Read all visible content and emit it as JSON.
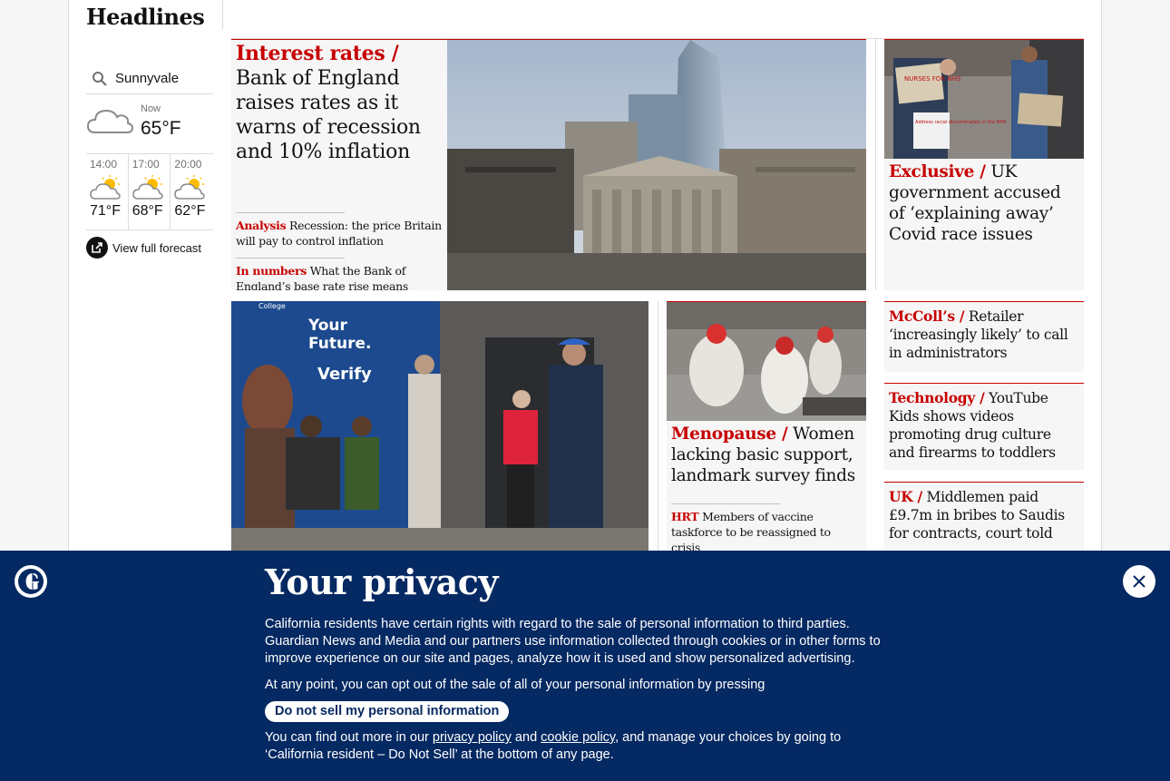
{
  "section": {
    "title": "Headlines"
  },
  "weather": {
    "location": "Sunnyvale",
    "now_label": "Now",
    "now_temp": "65°F",
    "forecast": [
      {
        "time": "14:00",
        "temp": "71°F"
      },
      {
        "time": "17:00",
        "temp": "68°F"
      },
      {
        "time": "20:00",
        "temp": "62°F"
      }
    ],
    "full_forecast_label": "View full forecast"
  },
  "main_story": {
    "kicker": "Interest rates /",
    "headline": "Bank of England raises rates as it warns of recession and 10% inflation",
    "sublinks": [
      {
        "kicker": "Analysis",
        "text": "Recession: the price Britain will pay to control inflation"
      },
      {
        "kicker": "In numbers",
        "text": "What the Bank of England’s base rate rise means"
      }
    ]
  },
  "exclusive_story": {
    "kicker": "Exclusive /",
    "headline": "UK government accused of ‘explaining away’ Covid race issues",
    "placards": [
      "Address racial discrimination in the NHS",
      "NURSES FOR NHS"
    ]
  },
  "small_stories": [
    {
      "kicker": "McColl’s /",
      "headline": "Retailer ‘increasingly likely’ to call in administrators"
    },
    {
      "kicker": "Technology /",
      "headline": "YouTube Kids shows videos promoting drug culture and firearms to toddlers"
    },
    {
      "kicker": "UK  /",
      "headline": "Middlemen paid £9.7m in bribes to Saudis for contracts, court told"
    }
  ],
  "photo_story": {
    "signage": [
      "College",
      "Your",
      "Future.",
      "Verify"
    ]
  },
  "menopause_story": {
    "kicker": "Menopause /",
    "headline": "Women lacking basic support, landmark survey finds",
    "sublink": {
      "kicker": "HRT",
      "text": "Members of vaccine taskforce to be reassigned to crisis"
    }
  },
  "privacy": {
    "title": "Your privacy",
    "paragraph1": "California residents have certain rights with regard to the sale of personal information to third parties. Guardian News and Media and our partners use information collected through cookies or in other forms to improve experience on our site and pages, analyze how it is used and show personalized advertising.",
    "paragraph2": "At any point, you can opt out of the sale of all of your personal information by pressing",
    "button_label": "Do not sell my personal information",
    "p3_before": "You can find out more in our ",
    "privacy_link": "privacy policy",
    "p3_and": " and ",
    "cookie_link": "cookie policy",
    "p3_after": ", and manage your choices by going to ‘California resident – Do Not Sell’ at the bottom of any page."
  },
  "colors": {
    "news_red": "#c70000",
    "brand_blue": "#052962",
    "card_bg": "#f6f6f6"
  }
}
